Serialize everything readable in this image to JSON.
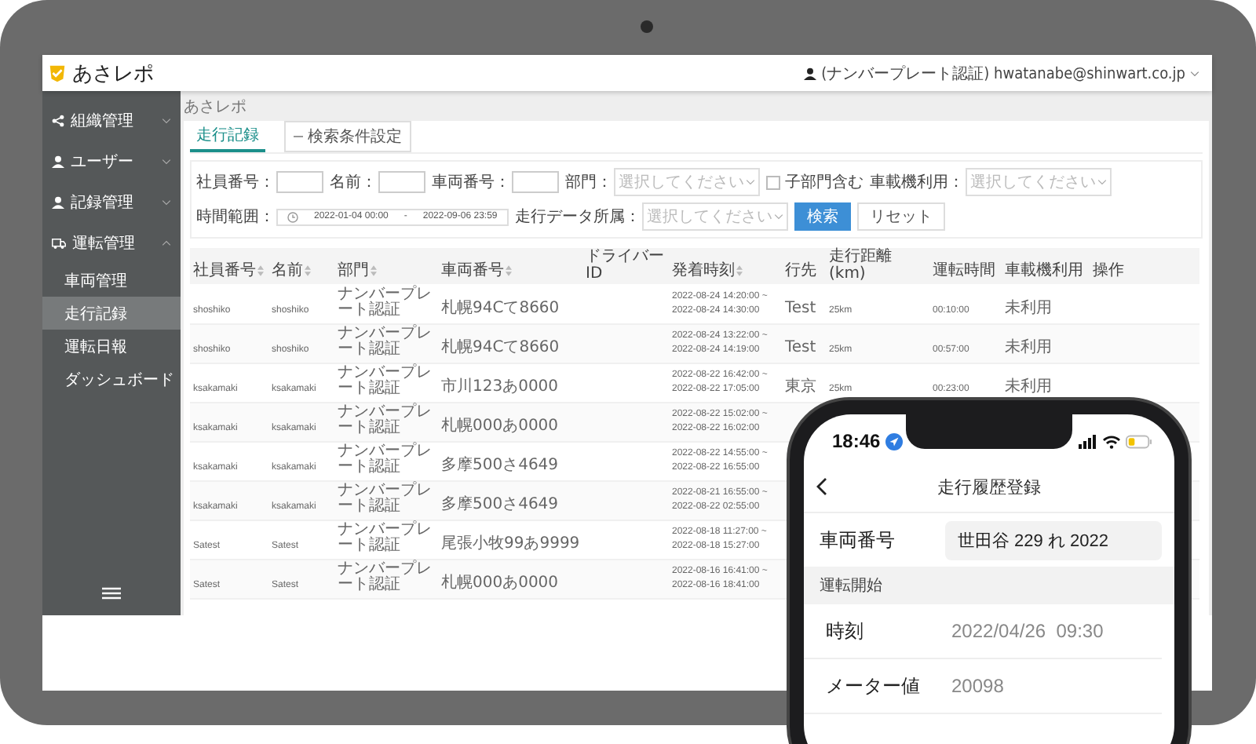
{
  "app": {
    "logo": "あさレポ",
    "user": "(ナンバープレート認証) hwatanabe@shinwart.co.jp"
  },
  "sidebar": {
    "items": [
      {
        "label": "組織管理",
        "expanded": false
      },
      {
        "label": "ユーザー",
        "expanded": false
      },
      {
        "label": "記録管理",
        "expanded": false
      },
      {
        "label": "運転管理",
        "expanded": true,
        "children": [
          {
            "label": "車両管理",
            "selected": false
          },
          {
            "label": "走行記録",
            "selected": true
          },
          {
            "label": "運転日報",
            "selected": false
          },
          {
            "label": "ダッシュボード",
            "selected": false
          }
        ]
      }
    ]
  },
  "breadcrumb": "あさレポ",
  "tabs": [
    {
      "label": "走行記録",
      "selected": true
    }
  ],
  "filter_toggle": "検索条件設定",
  "filters": [
    {
      "kind": "text",
      "label": "社員番号："
    },
    {
      "kind": "text",
      "label": "名前："
    },
    {
      "kind": "text",
      "label": "車両番号："
    },
    {
      "kind": "select",
      "label": "部門：",
      "placeholder": "選択してください"
    },
    {
      "kind": "checkbox",
      "label": "子部門含む",
      "checked": false
    },
    {
      "kind": "select",
      "label": "車載機利用：",
      "placeholder": "選択してください"
    },
    {
      "kind": "daterange",
      "label": "時間範囲：",
      "start": "2022-01-04 00:00",
      "separator": "-",
      "end": "2022-09-06 23:59"
    },
    {
      "kind": "select",
      "label": "走行データ所属：",
      "placeholder": "選択してください"
    }
  ],
  "buttons": [
    {
      "label": "検索",
      "kind": "primary"
    },
    {
      "label": "リセット",
      "kind": "default"
    }
  ],
  "table": {
    "columns": [
      {
        "label": "社員番号",
        "sortable": true
      },
      {
        "label": "名前",
        "sortable": true
      },
      {
        "label": "部門",
        "sortable": true
      },
      {
        "label": "車両番号",
        "sortable": true
      },
      {
        "label": "ドライバーID",
        "sortable": false
      },
      {
        "label": "発着時刻",
        "sortable": true
      },
      {
        "label": "行先",
        "sortable": false
      },
      {
        "label": "走行距離(km)",
        "sortable": false
      },
      {
        "label": "運転時間",
        "sortable": false
      },
      {
        "label": "車載機利用",
        "sortable": false
      },
      {
        "label": "操作",
        "sortable": false
      }
    ],
    "rows": [
      {
        "cells": [
          "shoshiko",
          "shoshiko",
          "ナンバープレート認証",
          "札幌94Cて8660",
          "",
          [
            "2022-08-24 14:20:00 ~",
            "2022-08-24 14:30:00"
          ],
          "Test",
          "25km",
          "00:10:00",
          "未利用"
        ]
      },
      {
        "cells": [
          "shoshiko",
          "shoshiko",
          "ナンバープレート認証",
          "札幌94Cて8660",
          "",
          [
            "2022-08-24 13:22:00 ~",
            "2022-08-24 14:19:00"
          ],
          "Test",
          "25km",
          "00:57:00",
          "未利用"
        ]
      },
      {
        "cells": [
          "ksakamaki",
          "ksakamaki",
          "ナンバープレート認証",
          "市川123あ0000",
          "",
          [
            "2022-08-22 16:42:00 ~",
            "2022-08-22 17:05:00"
          ],
          "東京",
          "25km",
          "00:23:00",
          "未利用"
        ]
      },
      {
        "cells": [
          "ksakamaki",
          "ksakamaki",
          "ナンバープレート認証",
          "札幌000あ0000",
          "",
          [
            "2022-08-22 15:02:00 ~",
            "2022-08-22 16:02:00"
          ]
        ]
      },
      {
        "cells": [
          "ksakamaki",
          "ksakamaki",
          "ナンバープレート認証",
          "多摩500さ4649",
          "",
          [
            "2022-08-22 14:55:00 ~",
            "2022-08-22 16:55:00"
          ]
        ]
      },
      {
        "cells": [
          "ksakamaki",
          "ksakamaki",
          "ナンバープレート認証",
          "多摩500さ4649",
          "",
          [
            "2022-08-21 16:55:00 ~",
            "2022-08-22 02:55:00"
          ]
        ]
      },
      {
        "cells": [
          "Satest",
          "Satest",
          "ナンバープレート認証",
          "尾張小牧99あ9999",
          "",
          [
            "2022-08-18 11:27:00 ~",
            "2022-08-18 15:27:00"
          ]
        ]
      },
      {
        "cells": [
          "Satest",
          "Satest",
          "ナンバープレート認証",
          "札幌000あ0000",
          "",
          [
            "2022-08-16 16:41:00 ~",
            "2022-08-16 18:41:00"
          ]
        ]
      }
    ]
  },
  "phone": {
    "time": "18:46",
    "title": "走行履歴登録",
    "fields": [
      {
        "kind": "input",
        "label": "車両番号",
        "value": "世田谷 229 れ 2022"
      },
      {
        "kind": "section",
        "label": "運転開始"
      },
      {
        "kind": "row",
        "label": "時刻",
        "value": "2022/04/26  09:30"
      },
      {
        "kind": "row",
        "label": "メーター値",
        "value": "20098"
      }
    ]
  }
}
